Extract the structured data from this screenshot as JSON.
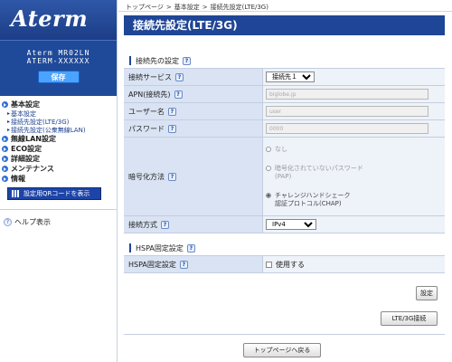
{
  "logo": {
    "text": "Aterm"
  },
  "device": {
    "model": "Aterm MR02LN",
    "ssid": "ATERM-XXXXXX",
    "save_label": "保存"
  },
  "menu": {
    "basic": "基本設定",
    "basic_sub": [
      "基本設定",
      "接続先設定(LTE/3G)",
      "接続先設定(公衆無線LAN)"
    ],
    "wlan": "無線LAN設定",
    "eco": "ECO設定",
    "detail": "詳細設定",
    "maint": "メンテナンス",
    "info": "情報",
    "qr_button": "設定用QRコードを表示",
    "help": "ヘルプ表示"
  },
  "breadcrumb": [
    "トップページ",
    ">",
    "基本設定",
    ">",
    "接続先設定(LTE/3G)"
  ],
  "page_title": "接続先設定(LTE/3G)",
  "section1": {
    "title": "接続先の設定",
    "service_label": "接続サービス",
    "service_value": "接続先１",
    "apn_label": "APN(接続先)",
    "apn_value": "biglobe.jp",
    "user_label": "ユーザー名",
    "user_value": "user",
    "pass_label": "パスワード",
    "pass_value": "0000",
    "auth_label": "暗号化方法",
    "auth_opt1": "なし",
    "auth_opt2a": "暗号化されていないパスワード",
    "auth_opt2b": "(PAP)",
    "auth_opt3a": "チャレンジハンドシェーク",
    "auth_opt3b": "認証プロトコル(CHAP)",
    "ip_label": "接続方式",
    "ip_value": "IPv4"
  },
  "section2": {
    "title": "HSPA固定設定",
    "fixed_label": "HSPA固定設定",
    "use_label": "使用する"
  },
  "buttons": {
    "set": "設定",
    "connect": "LTE/3G接続",
    "back": "トップページへ戻る"
  },
  "help_mark": "?"
}
